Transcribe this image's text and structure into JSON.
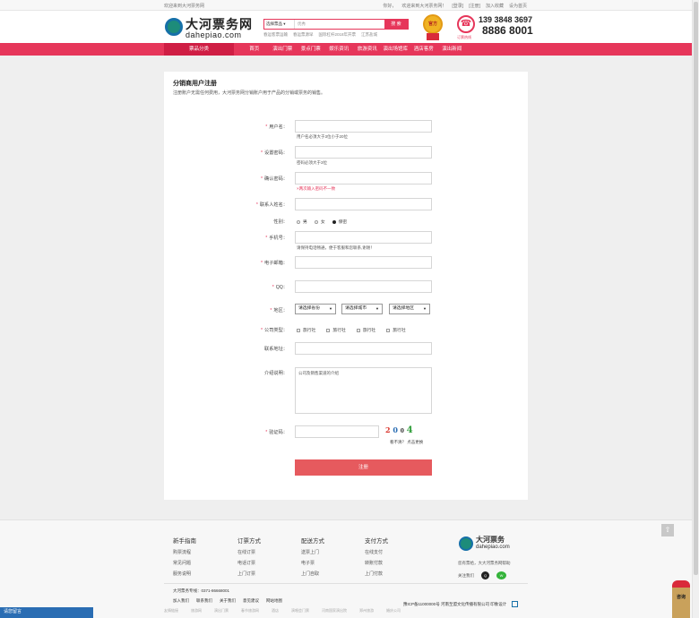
{
  "topbar": {
    "welcome": "欢迎来到大河票务网",
    "links": [
      "你好，",
      "欢迎来到大河票务网！",
      "[登录]",
      "[注册]",
      "加入收藏",
      "设为首页"
    ]
  },
  "header": {
    "logo_cn": "大河票务网",
    "logo_en": "dahepiao.com",
    "search_category": "选择票品 ▾",
    "search_placeholder": "优秀",
    "search_button": "搜 索",
    "hot_words": [
      "春运客票运输",
      "春运票源早",
      "国际杠杆2018年开票",
      "江苏盐城"
    ],
    "medal_text": "官方",
    "phone_label": "订票热线",
    "phone_line1": "139  3848  3697",
    "phone_line2": "8886  8001"
  },
  "nav": {
    "category_tab": "票品分类",
    "items": [
      "首页",
      "演出门票",
      "景点门票",
      "娱乐资讯",
      "旅游资讯",
      "演出场馆库",
      "酒店客房",
      "演出新闻"
    ]
  },
  "form": {
    "title": "分销商用户注册",
    "subtitle": "注册账户无需任何费用，大河票务网分销账户用于产品的分销或票务的销售。",
    "username_label": "用户名：",
    "username_hint": "用户名必须大于3位小于20位",
    "password_label": "设置密码：",
    "password_hint": "密码必须大于3位",
    "confirm_label": "确认密码：",
    "confirm_hint": "×两次输入密码不一致",
    "contact_label": "联系人姓名：",
    "gender_label": "性别：",
    "gender_options": [
      "男",
      "女",
      "保密"
    ],
    "mobile_label": "手机号：",
    "mobile_hint": "请保持电话畅通，便于客服和您联系,谢谢！",
    "email_label": "电子邮箱：",
    "qq_label": "QQ：",
    "region_label": "地区：",
    "province": "请选择省份",
    "city": "请选择城市",
    "district": "请选择地区",
    "company_type_label": "公司类型：",
    "company_types": [
      "旅行社",
      "旅行社",
      "旅行社",
      "旅行社"
    ],
    "address_label": "联系地址：",
    "intro_label": "介绍说明：",
    "intro_placeholder": "公司及销售渠道的介绍",
    "captcha_label": "验证码：",
    "captcha_chars": [
      "2",
      "0",
      "0",
      "4"
    ],
    "captcha_tip": "看不清？ 点击更换",
    "submit": "注册"
  },
  "footer": {
    "columns": [
      {
        "title": "新手指南",
        "items": [
          "购票流程",
          "常见问题",
          "服务说明"
        ]
      },
      {
        "title": "订票方式",
        "items": [
          "在线订票",
          "电话订票",
          "上门订票"
        ]
      },
      {
        "title": "配送方式",
        "items": [
          "送票上门",
          "电子票",
          "上门自取"
        ]
      },
      {
        "title": "支付方式",
        "items": [
          "在线支付",
          "转账付款",
          "上门付款"
        ]
      }
    ],
    "logo_cn": "大河票务",
    "logo_en": "dahepiao.com",
    "slogan": "您有票给，大大河票务网帮助",
    "follow": "关注我们",
    "hotline": "大河票务专线：0371-86668001",
    "links": [
      "加入我们",
      "联系我们",
      "关于我们",
      "意见建议",
      "网站地图"
    ],
    "copyright": "豫ICP备11000000号   河南至盟文化传播有限公司  印象设计",
    "bottom_links": [
      "友情链接",
      "旅游网",
      "演出门票",
      "春节旅游网",
      "酒店",
      "演唱会门票",
      "河南国家演出院",
      "郑州旅游",
      "婚庆公司"
    ]
  },
  "widgets": {
    "left_bar": "请您留言",
    "to_top": "⇧",
    "consult": "咨询"
  }
}
